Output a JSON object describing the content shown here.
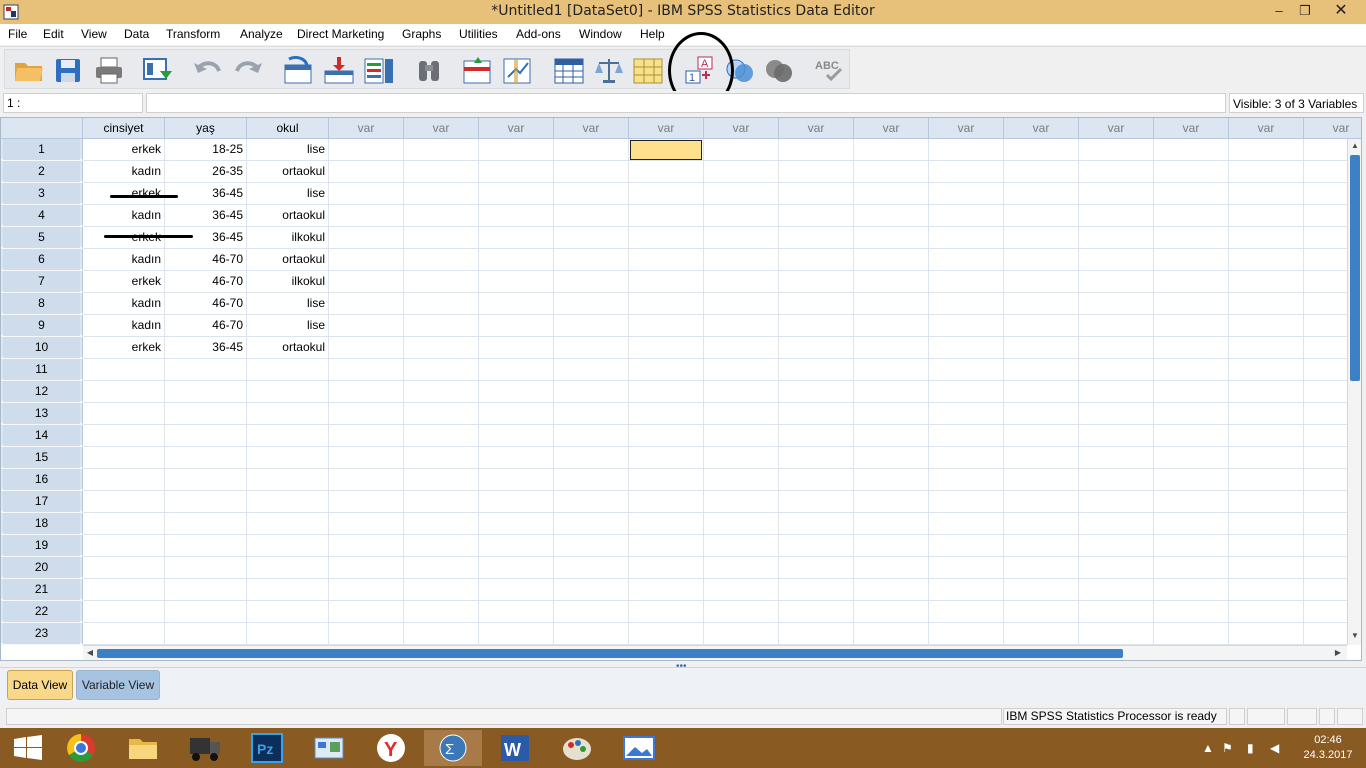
{
  "window": {
    "title": "*Untitled1 [DataSet0] - IBM SPSS Statistics Data Editor",
    "minimize": "‒",
    "maximize": "❐",
    "close": "✕"
  },
  "menu": [
    "File",
    "Edit",
    "View",
    "Data",
    "Transform",
    "Analyze",
    "Direct Marketing",
    "Graphs",
    "Utilities",
    "Add-ons",
    "Window",
    "Help"
  ],
  "toolbar": {
    "icons": [
      "open-icon",
      "save-icon",
      "print-icon",
      "dialog-recall-icon",
      "undo-icon",
      "redo-icon",
      "goto-case-icon",
      "goto-variable-icon",
      "variables-icon",
      "find-icon",
      "insert-cases-icon",
      "insert-variable-icon",
      "split-file-icon",
      "weight-cases-icon",
      "select-cases-icon",
      "value-labels-icon",
      "use-variable-sets-icon",
      "show-all-variables-icon",
      "spell-check-icon"
    ]
  },
  "editrow": {
    "cell_ref": "1 :",
    "cell_value": "",
    "visible": "Visible: 3 of 3 Variables"
  },
  "grid": {
    "columns": [
      "cinsiyet",
      "yaş",
      "okul",
      "var",
      "var",
      "var",
      "var",
      "var",
      "var",
      "var",
      "var",
      "var",
      "var",
      "var",
      "var",
      "var",
      "var"
    ],
    "row_numbers": [
      "1",
      "2",
      "3",
      "4",
      "5",
      "6",
      "7",
      "8",
      "9",
      "10",
      "11",
      "12",
      "13",
      "14",
      "15",
      "16",
      "17",
      "18",
      "19",
      "20",
      "21",
      "22",
      "23"
    ],
    "rows": [
      [
        "erkek",
        "18-25",
        "lise"
      ],
      [
        "kadın",
        "26-35",
        "ortaokul"
      ],
      [
        "erkek",
        "36-45",
        "lise"
      ],
      [
        "kadın",
        "36-45",
        "ortaokul"
      ],
      [
        "erkek",
        "36-45",
        "ilkokul"
      ],
      [
        "kadın",
        "46-70",
        "ortaokul"
      ],
      [
        "erkek",
        "46-70",
        "ilkokul"
      ],
      [
        "kadın",
        "46-70",
        "lise"
      ],
      [
        "kadın",
        "46-70",
        "lise"
      ],
      [
        "erkek",
        "36-45",
        "ortaokul"
      ]
    ]
  },
  "tabs": {
    "data_view": "Data View",
    "variable_view": "Variable View",
    "active": "Data View"
  },
  "status": {
    "text": "IBM SPSS Statistics Processor is ready"
  },
  "taskbar": {
    "apps": [
      "chrome-icon",
      "file-explorer-icon",
      "truck-app-icon",
      "photoshop-icon",
      "control-panel-icon",
      "yandex-icon",
      "spss-icon",
      "word-icon",
      "paint-icon",
      "photos-icon"
    ],
    "time": "02:46",
    "date": "24.3.2017"
  },
  "colors": {
    "title_bar": "#e7c07a",
    "header_bg": "#dce6f2",
    "selected_cell": "#ffe08c",
    "taskbar": "#8a5a23",
    "scroll_thumb": "#3c80c6"
  }
}
